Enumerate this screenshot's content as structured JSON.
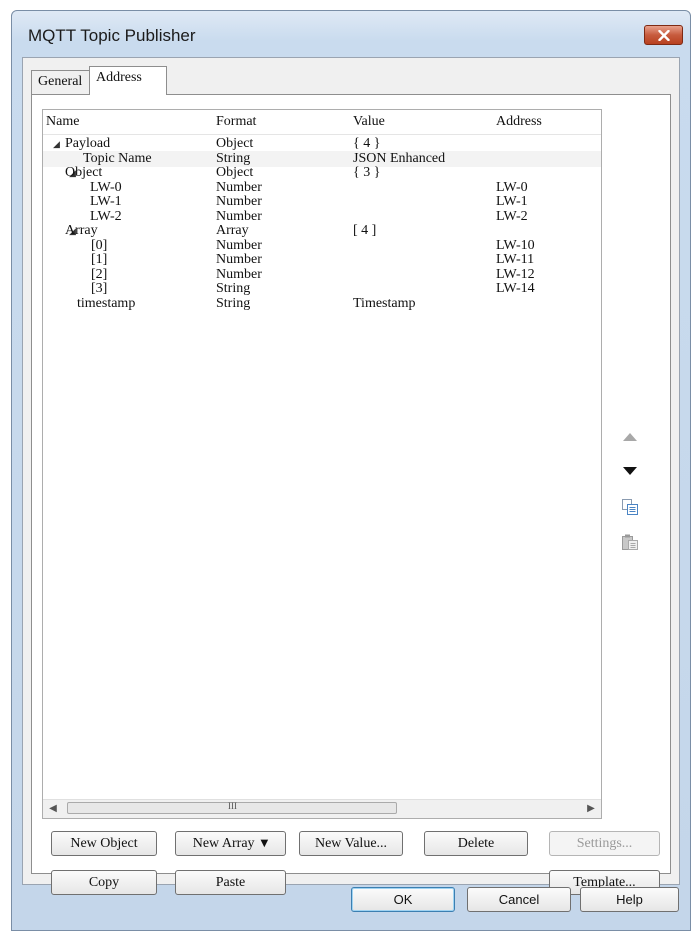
{
  "window": {
    "title": "MQTT Topic Publisher"
  },
  "tabs": [
    {
      "label": "General"
    },
    {
      "label": "Address"
    }
  ],
  "tree": {
    "columns": [
      "Name",
      "Format",
      "Value",
      "Address"
    ],
    "rows": [
      {
        "name": "Payload",
        "format": "Object",
        "value": "{ 4 }",
        "address": ""
      },
      {
        "name": "Topic Name",
        "format": "String",
        "value": "JSON Enhanced",
        "address": ""
      },
      {
        "name": "Object",
        "format": "Object",
        "value": "{ 3 }",
        "address": ""
      },
      {
        "name": "LW-0",
        "format": "Number",
        "value": "",
        "address": "LW-0"
      },
      {
        "name": "LW-1",
        "format": "Number",
        "value": "",
        "address": "LW-1"
      },
      {
        "name": "LW-2",
        "format": "Number",
        "value": "",
        "address": "LW-2"
      },
      {
        "name": "Array",
        "format": "Array",
        "value": "[ 4 ]",
        "address": ""
      },
      {
        "name": "[0]",
        "format": "Number",
        "value": "",
        "address": "LW-10"
      },
      {
        "name": "[1]",
        "format": "Number",
        "value": "",
        "address": "LW-11"
      },
      {
        "name": "[2]",
        "format": "Number",
        "value": "",
        "address": "LW-12"
      },
      {
        "name": "[3]",
        "format": "String",
        "value": "",
        "address": "LW-14"
      },
      {
        "name": "timestamp",
        "format": "String",
        "value": "Timestamp",
        "address": ""
      }
    ]
  },
  "scrollbar": {
    "grip": "III"
  },
  "side_icons": [
    "move-up-icon",
    "move-down-icon",
    "copy-icon",
    "paste-icon"
  ],
  "buttons": {
    "new_object": "New Object",
    "new_array": "New Array",
    "new_value": "New Value...",
    "delete": "Delete",
    "settings": "Settings...",
    "copy": "Copy",
    "paste": "Paste",
    "template": "Template...",
    "ok": "OK",
    "cancel": "Cancel",
    "help": "Help"
  },
  "colors": {
    "close_button": "#c75b3e",
    "title_bar": "#c9dbee",
    "ok_focus": "#3c7fb1"
  }
}
